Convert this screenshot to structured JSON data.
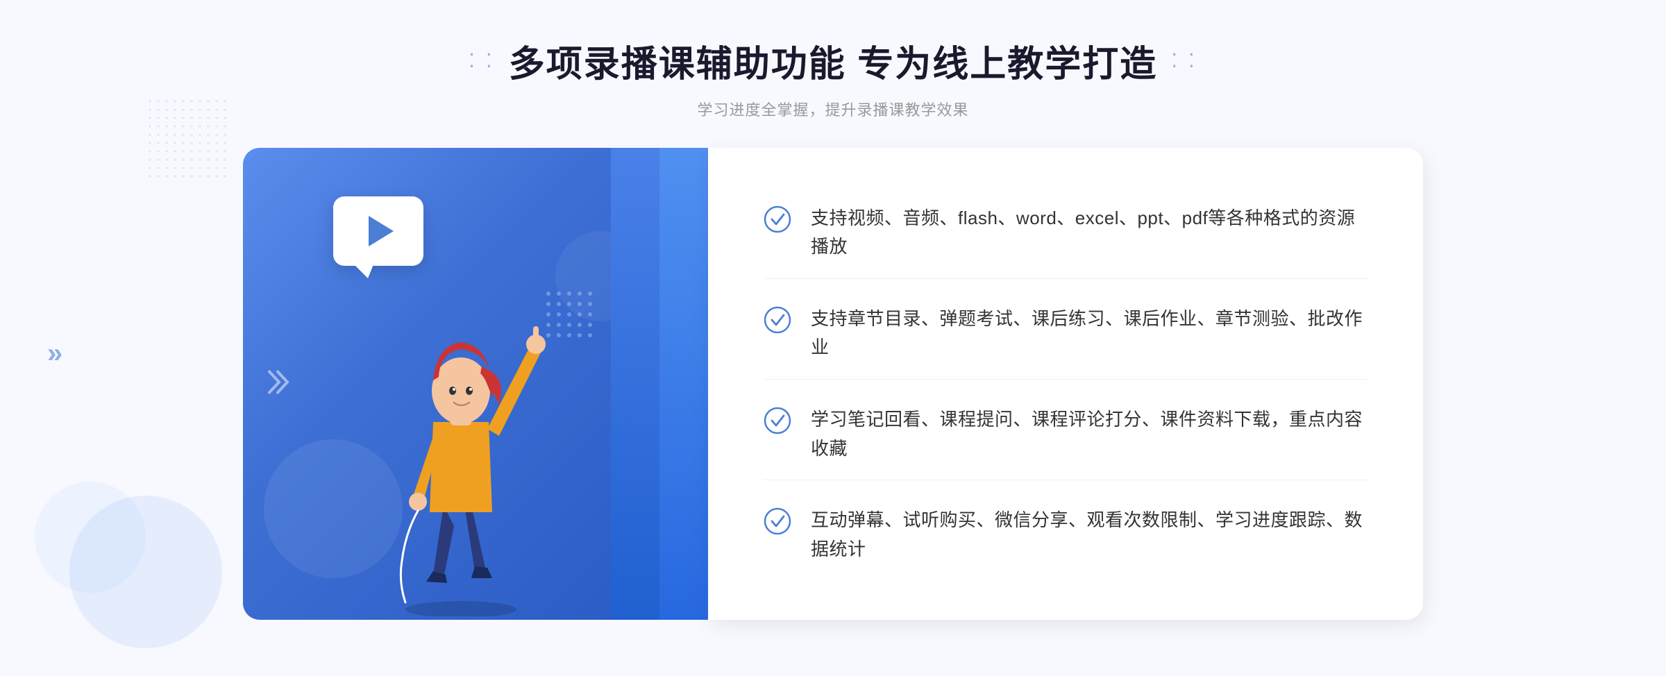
{
  "header": {
    "deco_left": ":: :",
    "deco_right": ": ::",
    "title": "多项录播课辅助功能 专为线上教学打造",
    "subtitle": "学习进度全掌握，提升录播课教学效果"
  },
  "features": [
    {
      "id": 1,
      "text": "支持视频、音频、flash、word、excel、ppt、pdf等各种格式的资源播放"
    },
    {
      "id": 2,
      "text": "支持章节目录、弹题考试、课后练习、课后作业、章节测验、批改作业"
    },
    {
      "id": 3,
      "text": "学习笔记回看、课程提问、课程评论打分、课件资料下载，重点内容收藏"
    },
    {
      "id": 4,
      "text": "互动弹幕、试听购买、微信分享、观看次数限制、学习进度跟踪、数据统计"
    }
  ],
  "colors": {
    "primary_blue": "#4a7fd4",
    "light_blue": "#5b8dee",
    "dark_blue": "#2a5bc4",
    "text_dark": "#1a1a2e",
    "text_medium": "#333333",
    "text_light": "#999999"
  }
}
